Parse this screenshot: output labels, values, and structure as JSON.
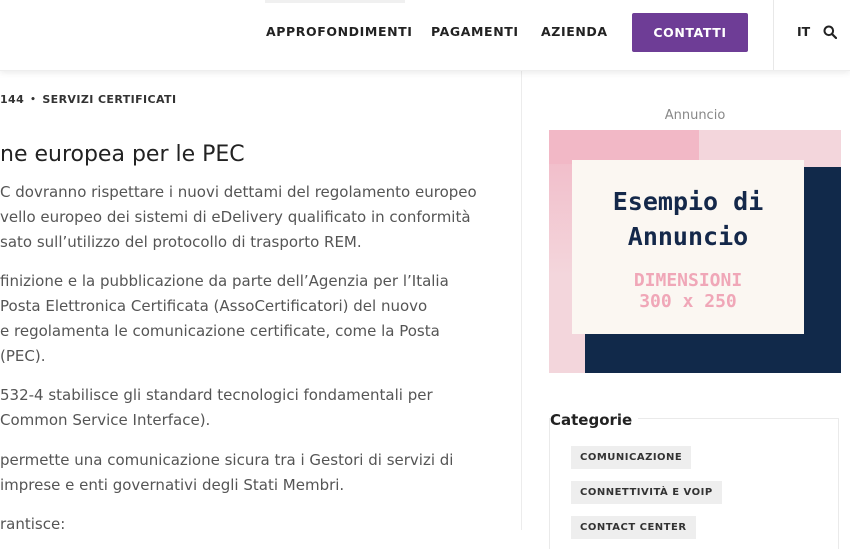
{
  "header": {
    "nav": [
      "APPROFONDIMENTI",
      "PAGAMENTI",
      "AZIENDA"
    ],
    "cta_label": "CONTATTI",
    "language": "IT",
    "search_icon": "search-icon",
    "accent_color": "#6e3d96"
  },
  "breadcrumb": {
    "prefix": "144",
    "separator": "•",
    "current": "SERVIZI CERTIFICATI"
  },
  "article": {
    "title": "ne europea per le PEC",
    "lines": [
      "C dovranno rispettare i nuovi dettami del regolamento europeo",
      "vello europeo dei sistemi di eDelivery qualificato in conformità",
      "sato sull’utilizzo del protocollo di trasporto REM.",
      "finizione e la pubblicazione da parte dell’Agenzia per l’Italia",
      " Posta Elettronica Certificata (AssoCertificatori) del nuovo",
      "e regolamenta le comunicazione certificate, come la Posta",
      " (PEC).",
      "532-4 stabilisce gli standard tecnologici fondamentali per",
      "Common Service Interface).",
      "permette una comunicazione sicura tra i Gestori di servizi di",
      "imprese e enti governativi degli Stati Membri.",
      "rantisce:"
    ]
  },
  "sidebar": {
    "ad_label": "Annuncio",
    "ad_title_line1": "Esempio di",
    "ad_title_line2": "Annuncio",
    "ad_dim_line1": "DIMENSIONI",
    "ad_dim_line2": "300 x 250",
    "categories_heading": "Categorie",
    "categories": [
      "COMUNICAZIONE",
      "CONNETTIVITÀ E VOIP",
      "CONTACT CENTER"
    ]
  }
}
